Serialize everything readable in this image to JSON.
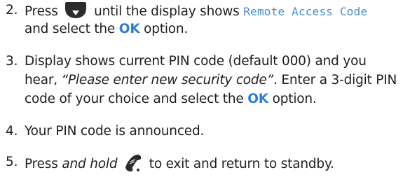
{
  "steps": [
    {
      "number": "2.",
      "before_icon": "Press",
      "icon_label": "Menu",
      "middle": "until the display shows",
      "display_text": "Remote Access Code",
      "line2_pre": "and select the",
      "ok": "OK",
      "line2_post": "option."
    },
    {
      "number": "3.",
      "line1": "Display shows current PIN code (default 000) and you",
      "line2_pre": "hear,",
      "quote": "“Please enter new security code”",
      "line2_post": ". Enter a 3-digit PIN",
      "line3_pre": "code of your choice and select the",
      "ok": "OK",
      "line3_post": "option."
    },
    {
      "number": "4.",
      "text": "Your PIN code is announced."
    },
    {
      "number": "5.",
      "pre": "Press",
      "italic": "and hold",
      "post": "to exit and return to standby."
    }
  ],
  "icons": {
    "menu_key": "menu-key-icon",
    "end_call_key": "handset-end-icon"
  },
  "colors": {
    "text": "#1e1e1e",
    "lcd_text": "#4b8cc8",
    "ok_highlight": "#2f7dd1",
    "key_fill": "#2b2b2b"
  }
}
